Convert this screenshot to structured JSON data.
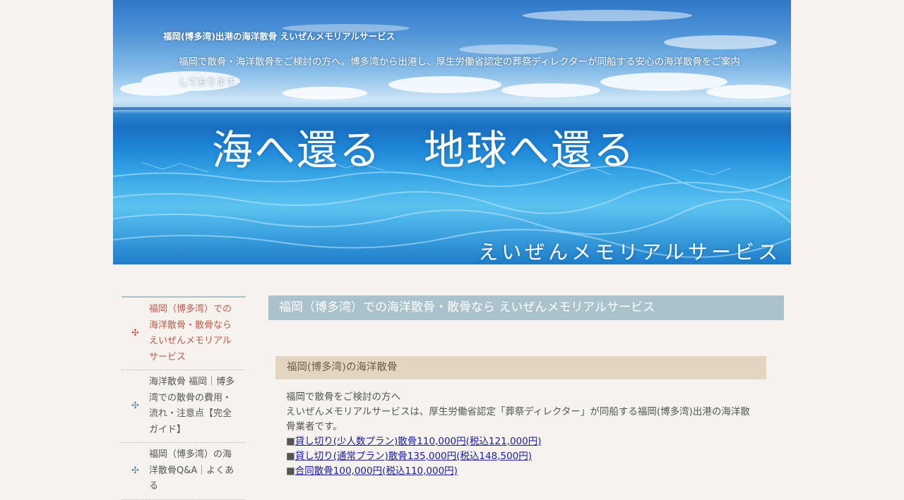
{
  "header": {
    "site_title": "福岡(博多湾)出港の海洋散骨 えいぜんメモリアルサービス",
    "description": "福岡で散骨・海洋散骨をご検討の方へ。博多湾から出港し、厚生労働省認定の葬祭ディレクターが同船する安心の海洋散骨をご案内しております。",
    "hero_text": "海へ還る　地球へ還る",
    "brand_text": "えいぜんメモリアルサービス"
  },
  "sidebar": {
    "items": [
      {
        "label": "福岡（博多湾）での海洋散骨・散骨ならえいぜんメモリアルサービス",
        "active": true
      },
      {
        "label": "海洋散骨 福岡｜博多湾での散骨の費用・流れ・注意点【完全ガイド】",
        "active": false
      },
      {
        "label": "福岡（博多湾）の海洋散骨Q&A｜よくある",
        "active": false
      }
    ]
  },
  "main": {
    "page_heading": "福岡（博多湾）での海洋散骨・散骨なら えいぜんメモリアルサービス",
    "section_heading": "福岡(博多湾)の海洋散骨",
    "intro_line1": "福岡で散骨をご検討の方へ",
    "intro_line2": "えいぜんメモリアルサービスは、厚生労働省認定「葬祭ディレクター」が同船する福岡(博多湾)出港の海洋散骨業者です。",
    "bullet_char": "■",
    "links": [
      "貸し切り(少人数プラン)散骨110,000円(税込121,000円)",
      "貸し切り(通常プラン)散骨135,000円(税込148,500円)",
      "合同散骨100,000円(税込110,000円)"
    ]
  },
  "icons": {
    "nav_cross": "✣"
  },
  "colors": {
    "page_bg": "#f6f3ee",
    "heading_bg": "#a9c2cb",
    "section_bg": "#e2d5c2",
    "active_nav": "#c0584a",
    "link": "#1a1aa8"
  }
}
